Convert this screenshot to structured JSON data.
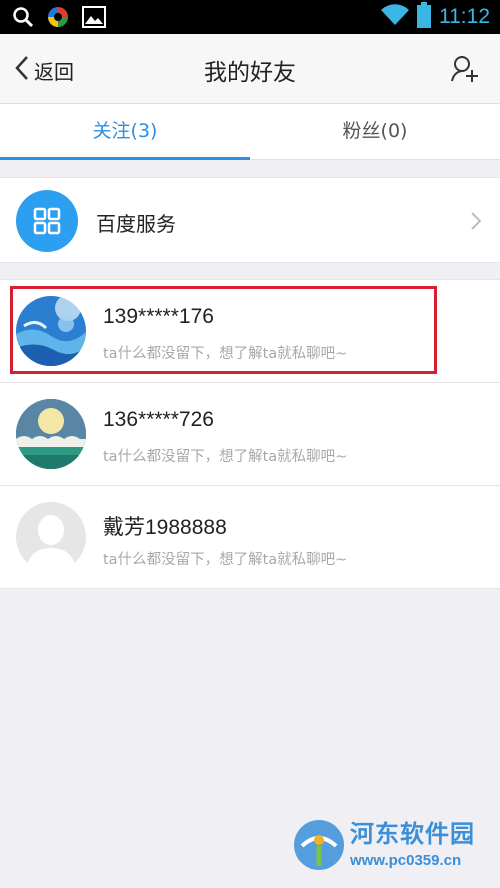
{
  "status_bar": {
    "time": "11:12",
    "icons": [
      "search-icon",
      "app-logo-icon",
      "image-icon",
      "wifi-icon",
      "battery-icon"
    ]
  },
  "nav": {
    "back_label": "返回",
    "title": "我的好友",
    "right_icon": "add-friend-icon"
  },
  "tabs": [
    {
      "label": "关注(3)",
      "active": true
    },
    {
      "label": "粉丝(0)",
      "active": false
    }
  ],
  "service": {
    "label": "百度服务",
    "icon": "grid-apps-icon"
  },
  "friends": [
    {
      "name": "139*****176",
      "signature": "ta什么都没留下，想了解ta就私聊吧~",
      "avatar": "ocean-avatar",
      "highlighted": true
    },
    {
      "name": "136*****726",
      "signature": "ta什么都没留下，想了解ta就私聊吧~",
      "avatar": "sunset-avatar",
      "highlighted": false
    },
    {
      "name": "戴芳1988888",
      "signature": "ta什么都没留下，想了解ta就私聊吧~",
      "avatar": "default-person-avatar",
      "highlighted": false
    }
  ],
  "watermark": {
    "title": "河东软件园",
    "url": "www.pc0359.cn"
  },
  "colors": {
    "accent": "#2b8fe8",
    "highlight_border": "#d42030",
    "background": "#efeff4"
  }
}
